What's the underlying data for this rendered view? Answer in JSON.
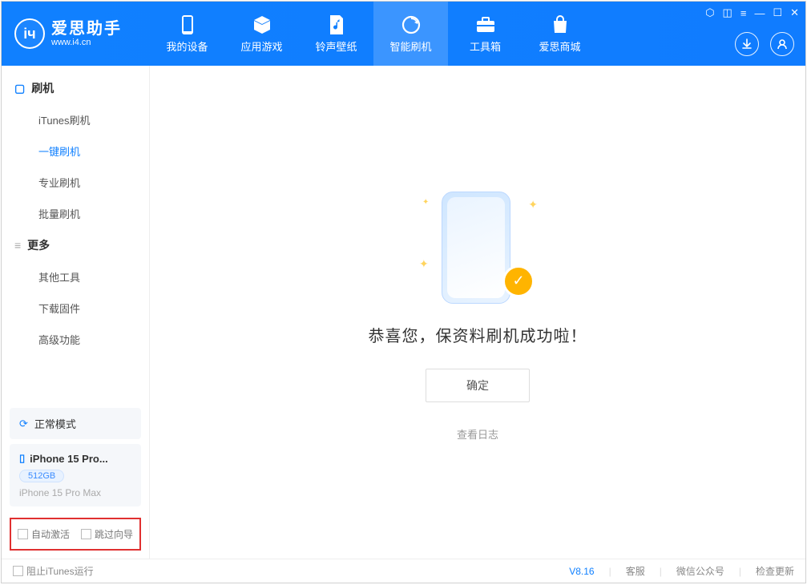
{
  "app": {
    "title": "爱思助手",
    "subtitle": "www.i4.cn"
  },
  "nav": {
    "items": [
      {
        "label": "我的设备"
      },
      {
        "label": "应用游戏"
      },
      {
        "label": "铃声壁纸"
      },
      {
        "label": "智能刷机"
      },
      {
        "label": "工具箱"
      },
      {
        "label": "爱思商城"
      }
    ]
  },
  "sidebar": {
    "group1": {
      "title": "刷机",
      "items": [
        "iTunes刷机",
        "一键刷机",
        "专业刷机",
        "批量刷机"
      ]
    },
    "group2": {
      "title": "更多",
      "items": [
        "其他工具",
        "下载固件",
        "高级功能"
      ]
    },
    "status_label": "正常模式",
    "device": {
      "name": "iPhone 15 Pro...",
      "capacity": "512GB",
      "model": "iPhone 15 Pro Max"
    },
    "checks": {
      "auto_activate": "自动激活",
      "skip_wizard": "跳过向导"
    }
  },
  "main": {
    "message": "恭喜您，保资料刷机成功啦！",
    "confirm": "确定",
    "view_log": "查看日志"
  },
  "footer": {
    "block_itunes": "阻止iTunes运行",
    "version": "V8.16",
    "support": "客服",
    "wechat": "微信公众号",
    "update": "检查更新"
  }
}
